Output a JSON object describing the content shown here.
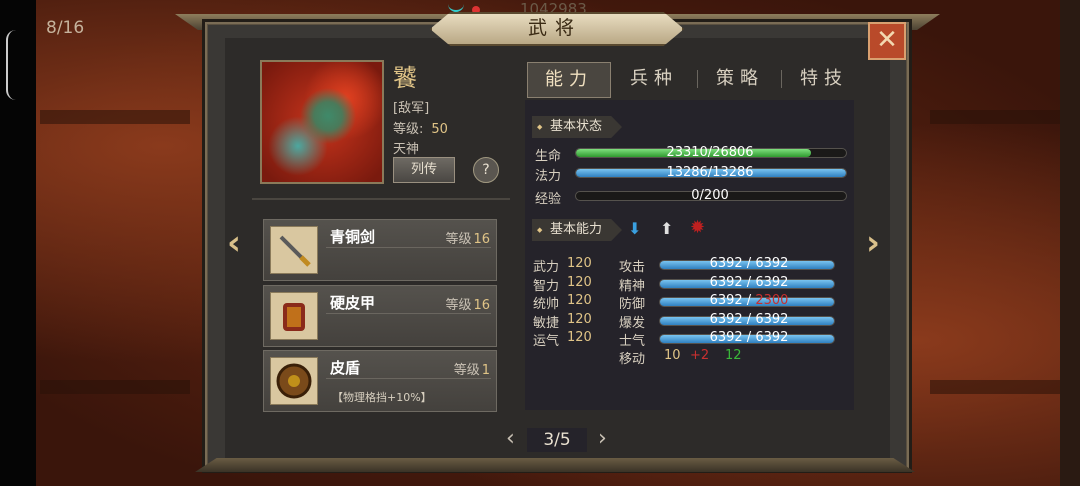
{
  "hud": {
    "page_counter": "8/16",
    "top_number": "1042983"
  },
  "panel": {
    "title": "武将"
  },
  "hero": {
    "name": "饕",
    "faction": "[敌军]",
    "level_label": "等级:",
    "level_value": "50",
    "type": "天神",
    "bio_button": "列传",
    "help_button": "?"
  },
  "equipment": [
    {
      "name": "青铜剑",
      "level_label": "等级",
      "level": "16",
      "desc": "",
      "icon": "sword-icon"
    },
    {
      "name": "硬皮甲",
      "level_label": "等级",
      "level": "16",
      "desc": "",
      "icon": "armor-icon"
    },
    {
      "name": "皮盾",
      "level_label": "等级",
      "level": "1",
      "desc": "【物理格挡+10%】",
      "icon": "shield-icon"
    }
  ],
  "tabs": [
    "能力",
    "兵种",
    "策略",
    "特技"
  ],
  "basic_status": {
    "title": "基本状态",
    "hp": {
      "label": "生命",
      "text": "23310/26806",
      "fraction": 0.87
    },
    "mp": {
      "label": "法力",
      "text": "13286/13286",
      "fraction": 1.0
    },
    "exp": {
      "label": "经验",
      "text": "0/200",
      "fraction": 0.0
    }
  },
  "basic_ability": {
    "title": "基本能力",
    "attributes": [
      {
        "name": "武力",
        "value": "120"
      },
      {
        "name": "智力",
        "value": "120"
      },
      {
        "name": "统帅",
        "value": "120"
      },
      {
        "name": "敏捷",
        "value": "120"
      },
      {
        "name": "运气",
        "value": "120"
      }
    ],
    "combat": [
      {
        "name": "攻击",
        "current": "6392",
        "max": "6392"
      },
      {
        "name": "精神",
        "current": "6392",
        "max": "6392"
      },
      {
        "name": "防御",
        "current": "6392",
        "max": "2300"
      },
      {
        "name": "爆发",
        "current": "6392",
        "max": "6392"
      },
      {
        "name": "士气",
        "current": "6392",
        "max": "6392"
      }
    ],
    "move": {
      "label": "移动",
      "base": "10",
      "bonus": "+2",
      "total": "12"
    }
  },
  "pager": {
    "text": "3/5"
  },
  "colors": {
    "hp_bar": "#4fbf4f",
    "mp_bar": "#3a9ad9",
    "accent_gold": "#e0c487"
  }
}
